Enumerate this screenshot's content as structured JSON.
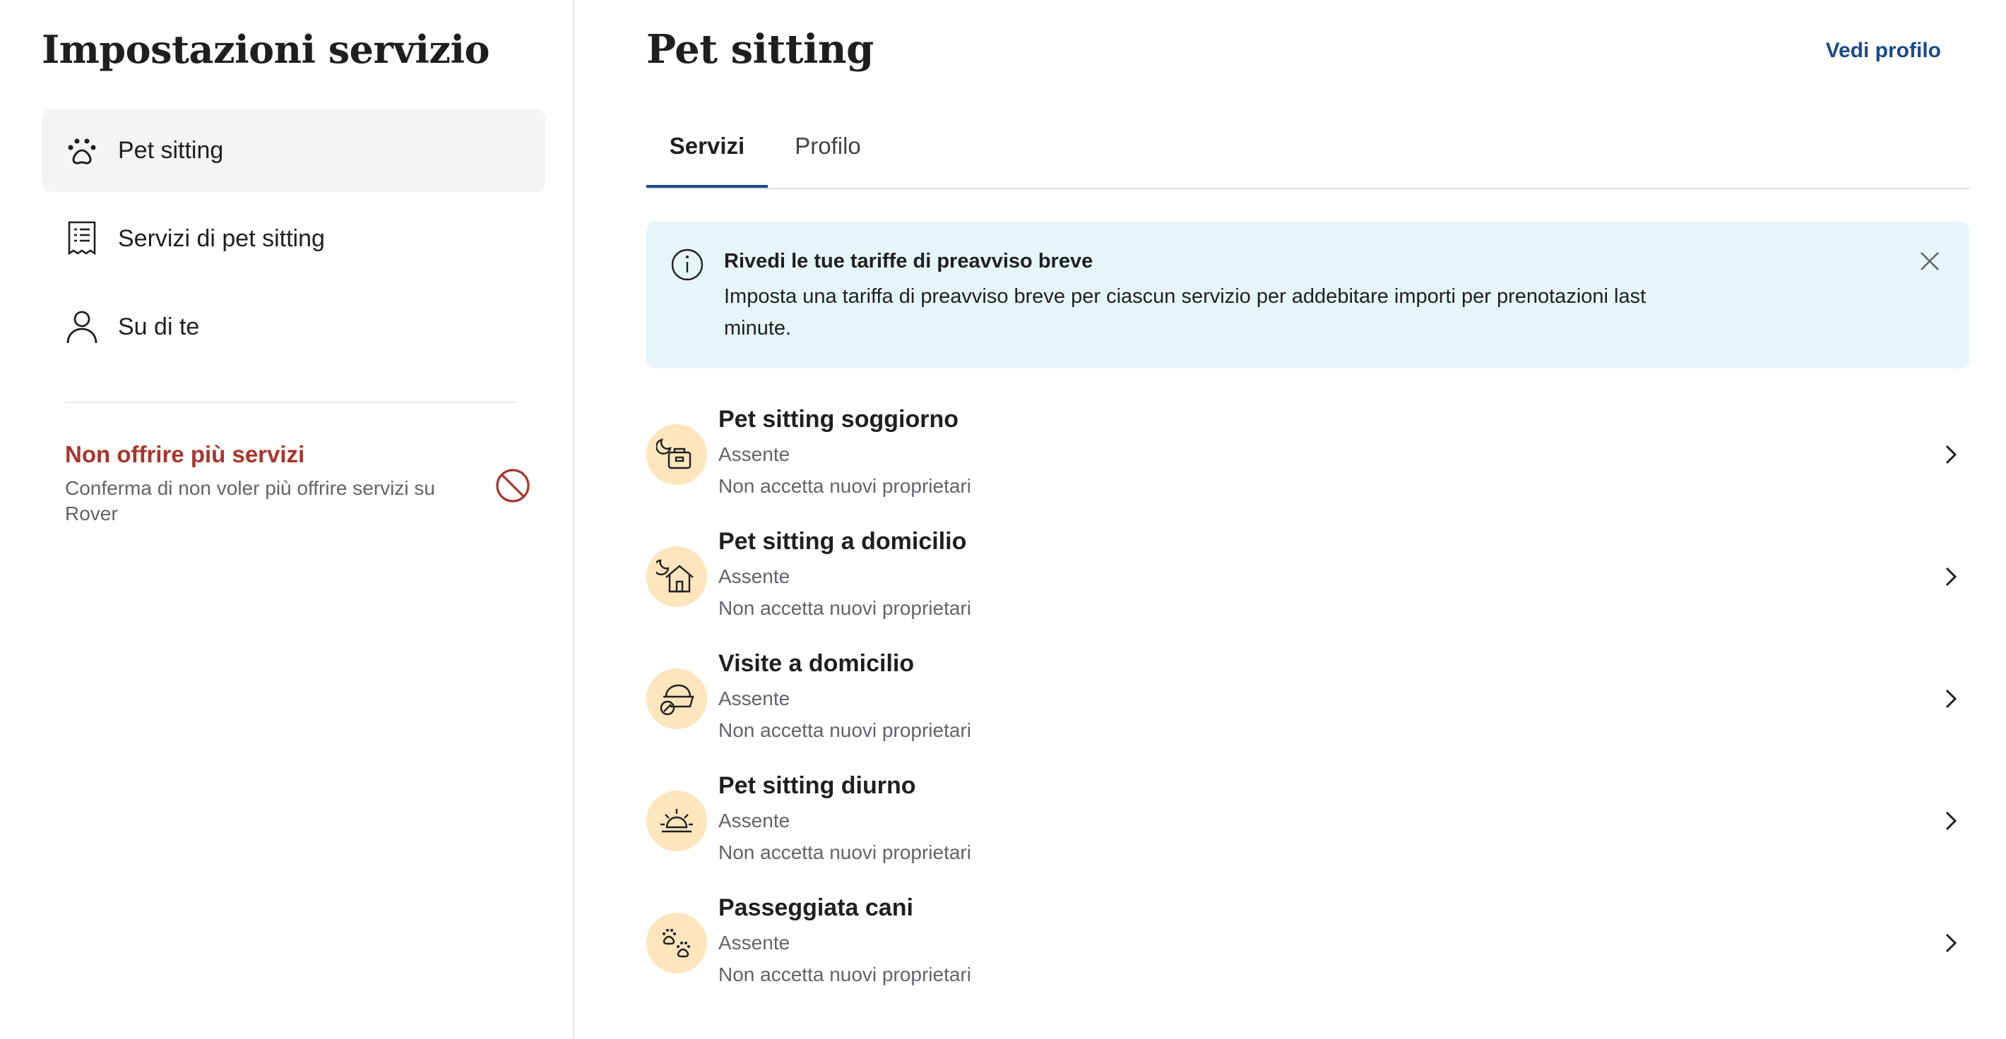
{
  "sidebar": {
    "title": "Impostazioni servizio",
    "items": [
      {
        "label": "Pet sitting",
        "icon": "paw-icon",
        "active": true
      },
      {
        "label": "Servizi di pet sitting",
        "icon": "receipt-icon",
        "active": false
      },
      {
        "label": "Su di te",
        "icon": "user-icon",
        "active": false
      }
    ],
    "stop_services": {
      "title": "Non offrire più servizi",
      "description": "Conferma di non voler più offrire servizi su Rover",
      "icon": "prohibited-icon",
      "color": "#a8362c"
    }
  },
  "main": {
    "title": "Pet sitting",
    "profile_link": "Vedi profilo",
    "tabs": [
      {
        "label": "Servizi",
        "active": true
      },
      {
        "label": "Profilo",
        "active": false
      }
    ],
    "alert": {
      "icon": "info-icon",
      "title": "Rivedi le tue tariffe di preavviso breve",
      "body": "Imposta una tariffa di preavviso breve per ciascun servizio per addebitare importi per prenotazioni last minute.",
      "close_icon": "close-icon",
      "background": "#e6f5fa"
    },
    "services": [
      {
        "name": "Pet sitting soggiorno",
        "status": "Assente",
        "sub": "Non accetta nuovi proprietari",
        "icon": "overnight-bag-icon"
      },
      {
        "name": "Pet sitting a domicilio",
        "status": "Assente",
        "sub": "Non accetta nuovi proprietari",
        "icon": "house-sitting-icon"
      },
      {
        "name": "Visite a domicilio",
        "status": "Assente",
        "sub": "Non accetta nuovi proprietari",
        "icon": "food-bowl-icon"
      },
      {
        "name": "Pet sitting diurno",
        "status": "Assente",
        "sub": "Non accetta nuovi proprietari",
        "icon": "sun-icon"
      },
      {
        "name": "Passeggiata cani",
        "status": "Assente",
        "sub": "Non accetta nuovi proprietari",
        "icon": "paw-prints-icon"
      }
    ]
  },
  "colors": {
    "accent": "#1b4a8a",
    "service_icon_bg": "#fde5bd",
    "active_nav_bg": "#f4f4f5"
  }
}
